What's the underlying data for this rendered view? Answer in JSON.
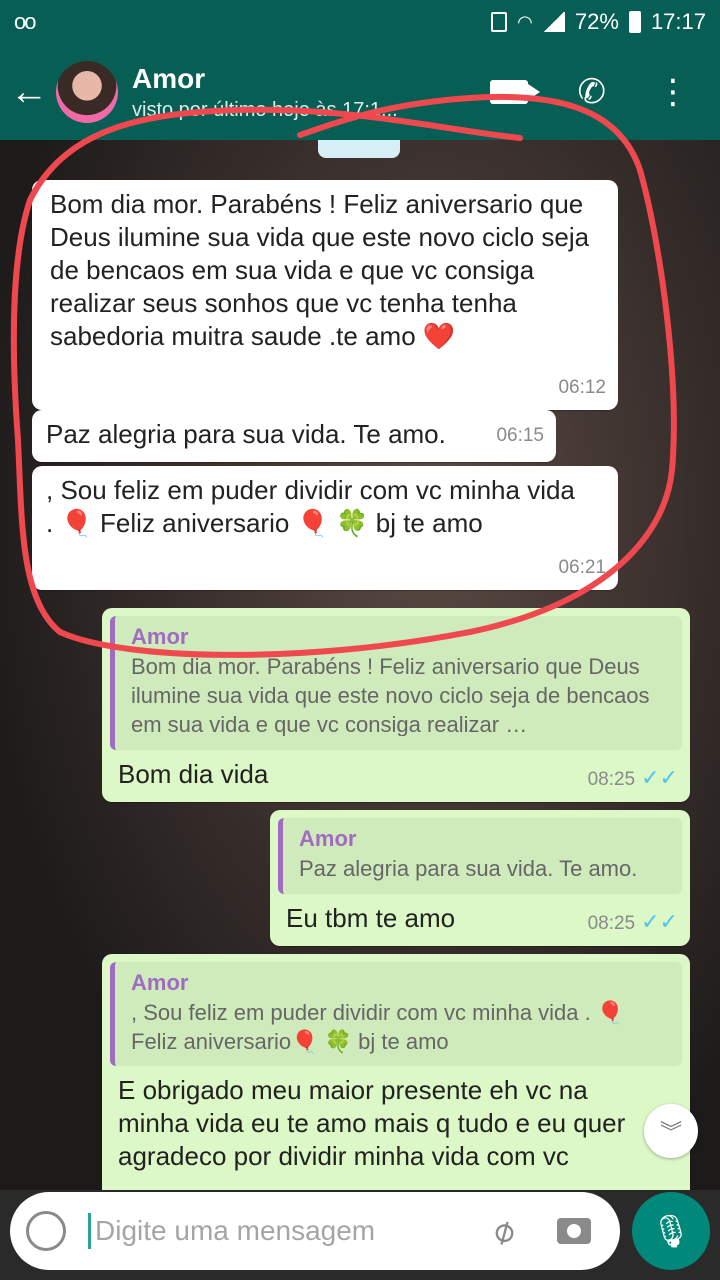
{
  "status_bar": {
    "battery": "72%",
    "time": "17:17",
    "voicemail": "oo"
  },
  "header": {
    "contact_name": "Amor",
    "last_seen": "visto por último hoje às 17:1..."
  },
  "messages": [
    {
      "text": "Bom dia mor. Parabéns ! Feliz aniversario que Deus ilumine sua vida que este novo ciclo seja de bencaos em sua vida e que vc consiga realizar seus sonhos que vc tenha tenha sabedoria muitra saude .te amo ❤️",
      "time": "06:12"
    },
    {
      "text": "Paz alegria para sua vida. Te amo.",
      "time": "06:15"
    },
    {
      "text": ", Sou feliz em puder dividir com vc  minha vida . 🎈 Feliz aniversario 🎈 🍀 bj te amo",
      "time": "06:21"
    },
    {
      "quote_name": "Amor",
      "quote_text": "Bom dia mor. Parabéns ! Feliz aniversario que Deus ilumine sua vida que este novo ciclo seja de bencaos em sua vida e que vc consiga realizar …",
      "text": "Bom dia vida",
      "time": "08:25",
      "ticks": "✓✓"
    },
    {
      "quote_name": "Amor",
      "quote_text": "Paz alegria para sua vida. Te amo.",
      "text": "Eu tbm te amo",
      "time": "08:25",
      "ticks": "✓✓"
    },
    {
      "quote_name": "Amor",
      "quote_text": ", Sou feliz em puder dividir com vc  minha vida . 🎈 Feliz aniversario🎈 🍀 bj te amo",
      "text": "E obrigado meu maior presente eh vc na minha vida eu te amo mais q tudo e eu quer agradeco por dividir minha vida com vc"
    }
  ],
  "composer": {
    "placeholder": "Digite uma mensagem"
  },
  "colors": {
    "header": "#075e54",
    "outgoing": "#dcf8c6",
    "incoming": "#ffffff",
    "quote_accent": "#a06cc2",
    "annotation": "#f0484f"
  }
}
